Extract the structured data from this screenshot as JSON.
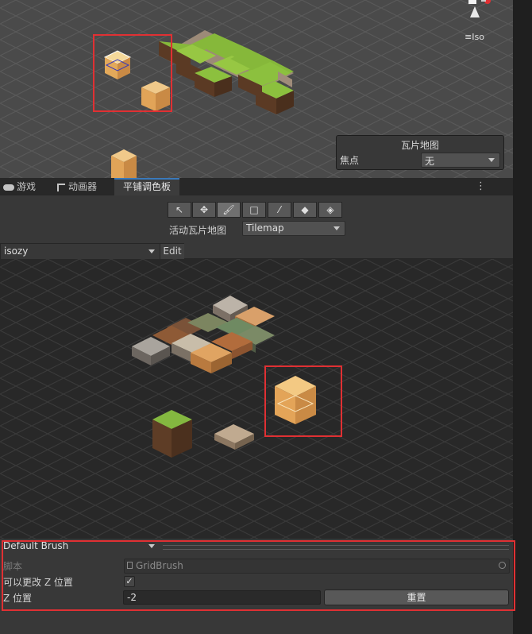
{
  "scene": {
    "gizmo_label": "Iso",
    "overlay": {
      "title": "瓦片地图",
      "focus_label": "焦点",
      "focus_value": "无"
    }
  },
  "tabs": [
    {
      "label": "游戏",
      "icon": "gamepad-icon",
      "active": false
    },
    {
      "label": "动画器",
      "icon": "animator-icon",
      "active": false
    },
    {
      "label": "平铺调色板",
      "icon": "",
      "active": true
    }
  ],
  "tab_menu_icon": "more-vertical-icon",
  "palette": {
    "tools": [
      "select-tool-icon",
      "move-tool-icon",
      "paint-brush-icon",
      "box-fill-icon",
      "picker-icon",
      "eraser-icon",
      "flood-fill-icon"
    ],
    "active_tool": "paint-brush-icon",
    "active_tilemap_label": "活动瓦片地图",
    "active_tilemap_value": "Tilemap",
    "palette_name": "isozy",
    "edit_label": "Edit"
  },
  "brush": {
    "selected": "Default Brush",
    "script_label": "脚本",
    "script_value": "GridBrush",
    "can_change_z_label": "可以更改 Z 位置",
    "can_change_z_checked": "✓",
    "z_position_label": "Z 位置",
    "z_position_value": "-2",
    "reset_label": "重置"
  },
  "colors": {
    "accent_highlight": "#e03033",
    "selection_blue": "#3a79bb"
  }
}
